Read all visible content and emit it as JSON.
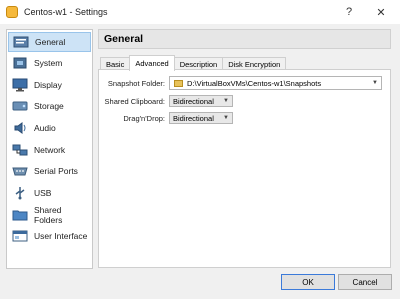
{
  "window": {
    "title": "Centos-w1 - Settings",
    "help_glyph": "?",
    "close_glyph": "✕"
  },
  "sidebar": {
    "items": [
      {
        "label": "General",
        "icon": "general-icon",
        "selected": true
      },
      {
        "label": "System",
        "icon": "system-icon"
      },
      {
        "label": "Display",
        "icon": "display-icon"
      },
      {
        "label": "Storage",
        "icon": "storage-icon"
      },
      {
        "label": "Audio",
        "icon": "audio-icon"
      },
      {
        "label": "Network",
        "icon": "network-icon"
      },
      {
        "label": "Serial Ports",
        "icon": "serial-ports-icon"
      },
      {
        "label": "USB",
        "icon": "usb-icon"
      },
      {
        "label": "Shared Folders",
        "icon": "shared-folders-icon"
      },
      {
        "label": "User Interface",
        "icon": "user-interface-icon"
      }
    ]
  },
  "main": {
    "title": "General",
    "tabs": [
      {
        "label": "Basic"
      },
      {
        "label": "Advanced",
        "active": true
      },
      {
        "label": "Description"
      },
      {
        "label": "Disk Encryption"
      }
    ],
    "advanced": {
      "snapshot_label": "Snapshot Folder:",
      "snapshot_value": "D:\\VirtualBoxVMs\\Centos-w1\\Snapshots",
      "clipboard_label": "Shared Clipboard:",
      "clipboard_value": "Bidirectional",
      "dragdrop_label": "Drag'n'Drop:",
      "dragdrop_value": "Bidirectional"
    }
  },
  "footer": {
    "ok_label": "OK",
    "cancel_label": "Cancel"
  }
}
